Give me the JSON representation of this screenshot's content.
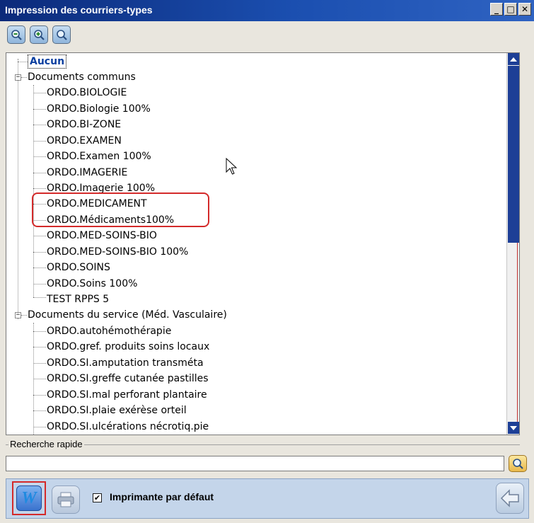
{
  "window": {
    "title": "Impression des courriers-types",
    "controls": {
      "minimize": "_",
      "maximize": "□",
      "close": "✕"
    }
  },
  "toolbar": {
    "buttons": [
      {
        "icon": "magnifier-minus-icon"
      },
      {
        "icon": "magnifier-plus-icon"
      },
      {
        "icon": "magnifier-icon"
      }
    ]
  },
  "tree": {
    "root_item": "Aucun",
    "groups": [
      {
        "label": "Documents communs",
        "expanded": true,
        "items": [
          "ORDO.BIOLOGIE",
          "ORDO.Biologie 100%",
          "ORDO.BI-ZONE",
          "ORDO.EXAMEN",
          "ORDO.Examen 100%",
          "ORDO.IMAGERIE",
          "ORDO.Imagerie 100%",
          "ORDO.MEDICAMENT",
          "ORDO.Médicaments100%",
          "ORDO.MED-SOINS-BIO",
          "ORDO.MED-SOINS-BIO 100%",
          "ORDO.SOINS",
          "ORDO.Soins 100%",
          "TEST RPPS 5"
        ]
      },
      {
        "label": "Documents du service (Méd. Vasculaire)",
        "expanded": true,
        "items": [
          "ORDO.autohémothérapie",
          "ORDO.gref. produits soins locaux",
          "ORDO.SI.amputation transméta",
          "ORDO.SI.greffe cutanée pastilles",
          "ORDO.SI.mal perforant plantaire",
          "ORDO.SI.plaie exérèse orteil",
          "ORDO.SI.ulcérations nécrotiq.pie"
        ]
      }
    ],
    "expander_symbol": "−",
    "highlight_color": "#d42a2a"
  },
  "search": {
    "label": "Recherche rapide",
    "value": "",
    "button_icon": "magnifier-icon"
  },
  "bottom": {
    "word_button_glyph": "W",
    "printer_icon": "printer-icon",
    "default_printer_checked": true,
    "default_printer_check": "✔",
    "default_printer_label": "Imprimante par défaut",
    "back_icon": "arrow-left-icon"
  }
}
